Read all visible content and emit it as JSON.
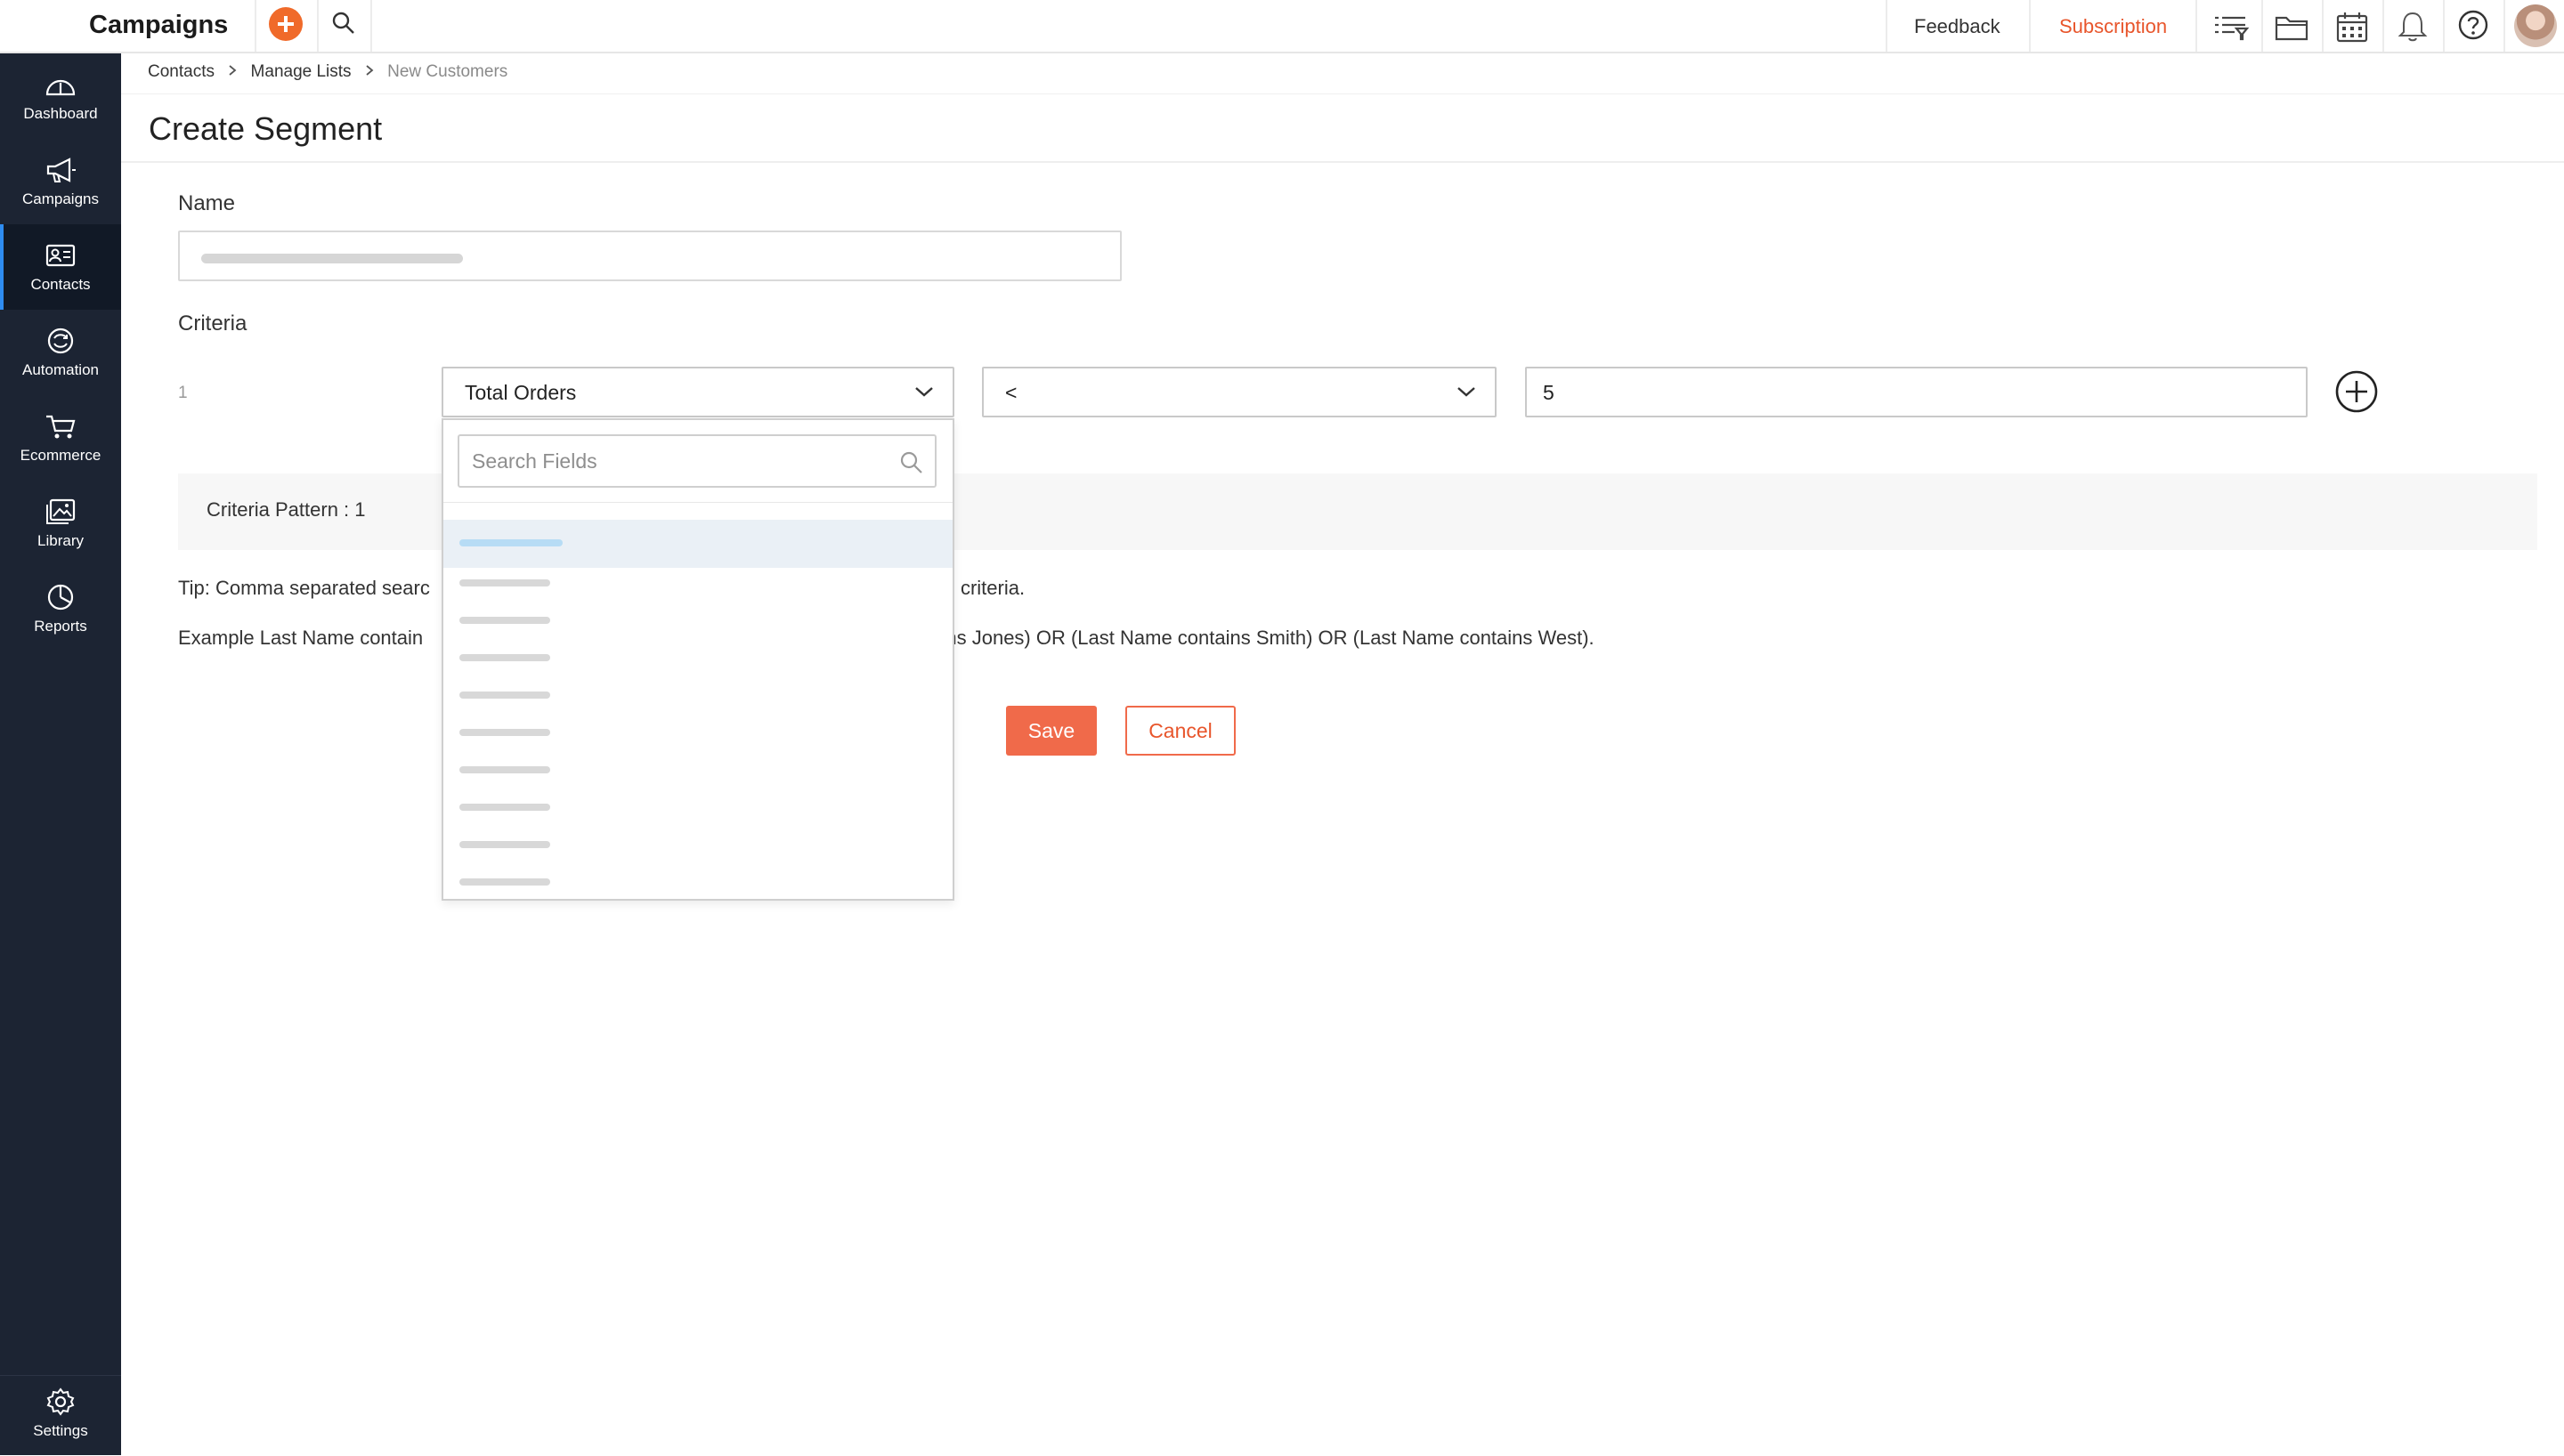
{
  "app": {
    "title": "Campaigns"
  },
  "topbar": {
    "feedback": "Feedback",
    "subscription": "Subscription",
    "icons": [
      "create-plus-icon",
      "search-icon",
      "list-filter-icon",
      "folder-icon",
      "calendar-icon",
      "bell-icon",
      "help-icon",
      "avatar"
    ]
  },
  "sidebar": {
    "items": [
      {
        "label": "Dashboard",
        "icon": "dashboard-gauge-icon"
      },
      {
        "label": "Campaigns",
        "icon": "megaphone-icon"
      },
      {
        "label": "Contacts",
        "icon": "contact-card-icon",
        "active": true
      },
      {
        "label": "Automation",
        "icon": "automation-icon"
      },
      {
        "label": "Ecommerce",
        "icon": "cart-icon"
      },
      {
        "label": "Library",
        "icon": "image-library-icon"
      },
      {
        "label": "Reports",
        "icon": "pie-chart-icon"
      }
    ],
    "settings": "Settings"
  },
  "breadcrumb": {
    "items": [
      "Contacts",
      "Manage Lists"
    ],
    "current": "New Customers"
  },
  "page": {
    "title": "Create Segment"
  },
  "form": {
    "name_label": "Name",
    "criteria_label": "Criteria",
    "row_number": "1",
    "field_select": "Total Orders",
    "operator_select": "<",
    "value": "5",
    "pattern": "Criteria Pattern : 1",
    "tip_start": "Tip: Comma separated searc",
    "tip_end": " criteria.",
    "example_start": "Example  Last Name contain",
    "example_end": "tains Jones) OR (Last Name contains Smith) OR (Last Name contains West).",
    "save": "Save",
    "cancel": "Cancel"
  },
  "dropdown": {
    "search_placeholder": "Search Fields"
  },
  "colors": {
    "accent": "#f06a2a",
    "sidebar_bg": "#1c2433",
    "subscription": "#e8552b",
    "highlight": "#eaf0f6"
  }
}
